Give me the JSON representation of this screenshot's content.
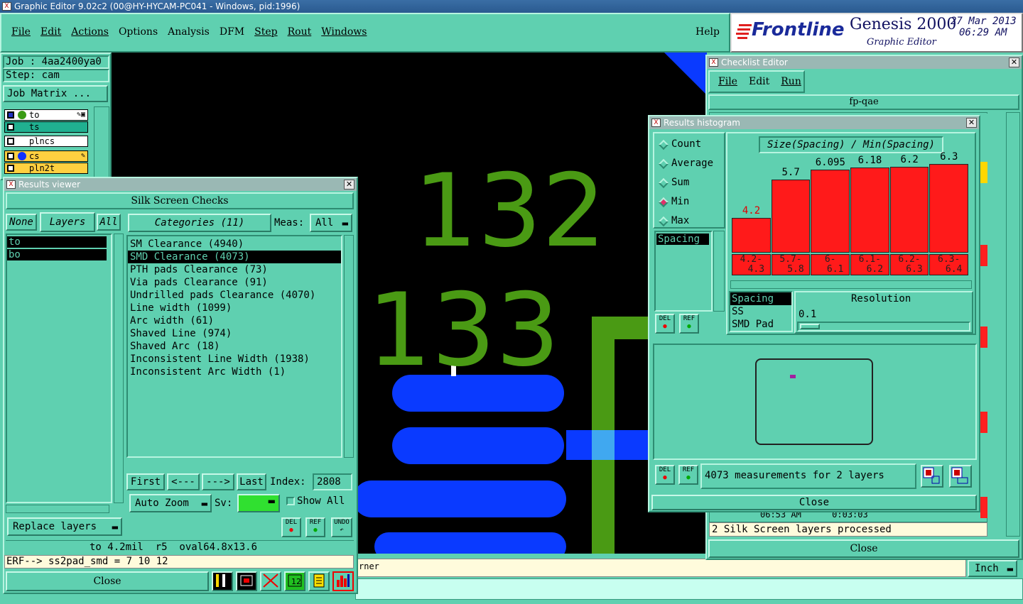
{
  "app": {
    "title": "Graphic Editor 9.02c2 (00@HY-HYCAM-PC041 - Windows, pid:1996)",
    "menu": [
      "File",
      "Edit",
      "Actions",
      "Options",
      "Analysis",
      "DFM",
      "Step",
      "Rout",
      "Windows"
    ],
    "help": "Help",
    "brand": "Frontline",
    "product": "Genesis 2000",
    "subtitle": "Graphic Editor",
    "date": "27 Mar 2013",
    "time": "06:29 AM"
  },
  "left_panel": {
    "job": "Job : 4aa2400ya0",
    "step": "Step: cam",
    "job_matrix": "Job Matrix ...",
    "layers": [
      {
        "name": "to",
        "color": "#ffffff"
      },
      {
        "name": "ts",
        "color": "#20b090"
      },
      {
        "name": "plncs",
        "color": "#ffffff"
      },
      {
        "name": "cs",
        "color": "#ffd040"
      },
      {
        "name": "pln2t",
        "color": "#ffd040"
      }
    ]
  },
  "canvas": {
    "numbers": [
      "132",
      "133"
    ],
    "colors": {
      "silk": "#4a9a14",
      "pad": "#0a3aff",
      "background": "#000000"
    }
  },
  "results_viewer": {
    "title": "Results viewer",
    "header": "Silk Screen Checks",
    "btn_none": "None",
    "btn_layers": "Layers",
    "btn_all": "All",
    "layers": [
      "to",
      "bo"
    ],
    "categories_label": "Categories (11)",
    "meas_label": "Meas:",
    "meas_value": "All",
    "categories": [
      "SM Clearance (4940)",
      "SMD Clearance (4073)",
      "PTH pads Clearance (73)",
      "Via pads Clearance (91)",
      "Undrilled pads Clearance (4070)",
      "Line width (1099)",
      "Arc width (61)",
      "Shaved Line (974)",
      "Shaved Arc (18)",
      "Inconsistent Line Width (1938)",
      "Inconsistent Arc Width (1)"
    ],
    "selected_index": 1,
    "nav": {
      "first": "First",
      "prev": "<---",
      "next": "--->",
      "last": "Last",
      "index_label": "Index:",
      "index_value": "2808"
    },
    "auto_zoom": "Auto Zoom",
    "sv_label": "Sv:",
    "show_all": "Show All",
    "replace_layers": "Replace layers",
    "btn_del": "DEL",
    "btn_ref": "REF",
    "btn_undo": "UNDO",
    "status": "to 4.2mil  r5  oval64.8x13.6",
    "erf": "ERF--> ss2pad_smd = 7 10 12",
    "close": "Close"
  },
  "checklist": {
    "title": "Checklist Editor",
    "menu": [
      "File",
      "Edit",
      "Run"
    ],
    "name": "fp-qae",
    "row": "06:53 AM      0:03:03",
    "log": "2 Silk Screen layers processed",
    "close": "Close",
    "partial_status": "rner",
    "units": "Inch"
  },
  "histogram": {
    "title": "Results histogram",
    "modes": [
      "Count",
      "Average",
      "Sum",
      "Min",
      "Max"
    ],
    "selected_mode": "Min",
    "list": [
      "Spacing"
    ],
    "chart_title": "Size(Spacing) / Min(Spacing)",
    "measures": [
      "Spacing",
      "SS",
      "SMD Pad"
    ],
    "resolution_label": "Resolution",
    "resolution_value": "0.1",
    "btn_del": "DEL",
    "btn_ref": "REF",
    "info": "4073 measurements for 2 layers",
    "close": "Close"
  },
  "chart_data": {
    "type": "bar",
    "title": "Size(Spacing) / Min(Spacing)",
    "categories": [
      "4.2-4.3",
      "5.7-5.8",
      "6-6.1",
      "6.1-6.2",
      "6.2-6.3",
      "6.3-6.4"
    ],
    "values": [
      4.2,
      5.7,
      6.095,
      6.18,
      6.2,
      6.3
    ],
    "value_labels": [
      "4.2",
      "5.7",
      "6.095",
      "6.18",
      "6.2",
      "6.3"
    ],
    "bin_labels": [
      [
        "4.2-",
        "4.3"
      ],
      [
        "5.7-",
        "5.8"
      ],
      [
        "6-",
        "6.1"
      ],
      [
        "6.1-",
        "6.2"
      ],
      [
        "6.2-",
        "6.3"
      ],
      [
        "6.3-",
        "6.4"
      ]
    ],
    "ylim": [
      0,
      6.5
    ],
    "grid": false,
    "legend": "none",
    "colors": {
      "bar": "#ff1a1a",
      "first_label": "#e00000"
    }
  }
}
